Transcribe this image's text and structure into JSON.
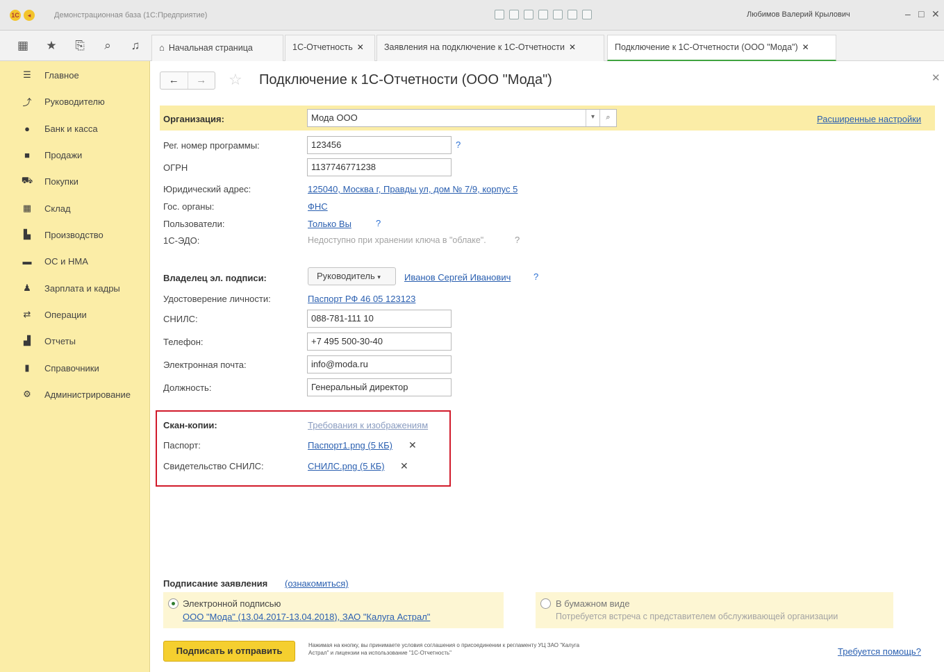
{
  "titlebar": {
    "app_name": "Демонстрационная база (1С:Предприятие)",
    "user": "Любимов Валерий Крылович"
  },
  "tabs": [
    {
      "label": "Начальная страница"
    },
    {
      "label": "1С-Отчетность"
    },
    {
      "label": "Заявления на подключение к 1С-Отчетности"
    },
    {
      "label": "Подключение к 1С-Отчетности (ООО \"Мода\")"
    }
  ],
  "sidebar": {
    "items": [
      {
        "label": "Главное",
        "icon": "menu-icon"
      },
      {
        "label": "Руководителю",
        "icon": "trend-icon"
      },
      {
        "label": "Банк и касса",
        "icon": "coin-icon"
      },
      {
        "label": "Продажи",
        "icon": "bag-icon"
      },
      {
        "label": "Покупки",
        "icon": "cart-icon"
      },
      {
        "label": "Склад",
        "icon": "warehouse-icon"
      },
      {
        "label": "Производство",
        "icon": "factory-icon"
      },
      {
        "label": "ОС и НМА",
        "icon": "truck-icon"
      },
      {
        "label": "Зарплата и кадры",
        "icon": "person-icon"
      },
      {
        "label": "Операции",
        "icon": "operations-icon"
      },
      {
        "label": "Отчеты",
        "icon": "bar-chart-icon"
      },
      {
        "label": "Справочники",
        "icon": "book-icon"
      },
      {
        "label": "Администрирование",
        "icon": "gear-icon"
      }
    ]
  },
  "page": {
    "title": "Подключение к 1С-Отчетности (ООО \"Мода\")"
  },
  "form": {
    "org_label": "Организация:",
    "org_value": "Мода ООО",
    "advanced_settings": "Расширенные настройки",
    "reg_num_label": "Рег. номер программы:",
    "reg_num_value": "123456",
    "ogrn_label": "ОГРН",
    "ogrn_value": "1137746771238",
    "address_label": "Юридический адрес:",
    "address_value": "125040, Москва г, Правды ул, дом № 7/9, корпус 5",
    "gov_label": "Гос. органы:",
    "gov_value": "ФНС",
    "users_label": "Пользователи:",
    "users_value": "Только Вы",
    "edo_label": "1С-ЭДО:",
    "edo_value": "Недоступно при хранении ключа в \"облаке\".",
    "owner_label": "Владелец эл. подписи:",
    "owner_role": "Руководитель",
    "owner_name": "Иванов Сергей Иванович",
    "id_label": "Удостоверение личности:",
    "id_value": "Паспорт РФ 46 05 123123",
    "snils_label": "СНИЛС:",
    "snils_value": "088-781-111 10",
    "phone_label": "Телефон:",
    "phone_value": "+7 495 500-30-40",
    "email_label": "Электронная почта:",
    "email_value": "info@moda.ru",
    "position_label": "Должность:",
    "position_value": "Генеральный директор"
  },
  "scans": {
    "label": "Скан-копии:",
    "requirements": "Требования к изображениям",
    "passport_label": "Паспорт:",
    "passport_file": "Паспорт1.png (5 КБ)",
    "snils_label": "Свидетельство СНИЛС:",
    "snils_file": "СНИЛС.png (5 КБ)"
  },
  "signing": {
    "label": "Подписание заявления",
    "read_link": "(ознакомиться)",
    "electronic_label": "Электронной подписью",
    "electronic_detail": "ООО \"Мода\" (13.04.2017-13.04.2018), ЗАО \"Калуга Астрал\"",
    "paper_label": "В бумажном виде",
    "paper_detail": "Потребуется встреча с представителем обслуживающей организации",
    "submit_button": "Подписать и отправить",
    "fine_print": "Нажимая на кнопку, вы принимаете условия соглашения о присоединении к регламенту УЦ ЗАО \"Калуга Астрал\" и лицензии на использование \"1С-Отчетность\"",
    "help_link": "Требуется помощь?"
  }
}
